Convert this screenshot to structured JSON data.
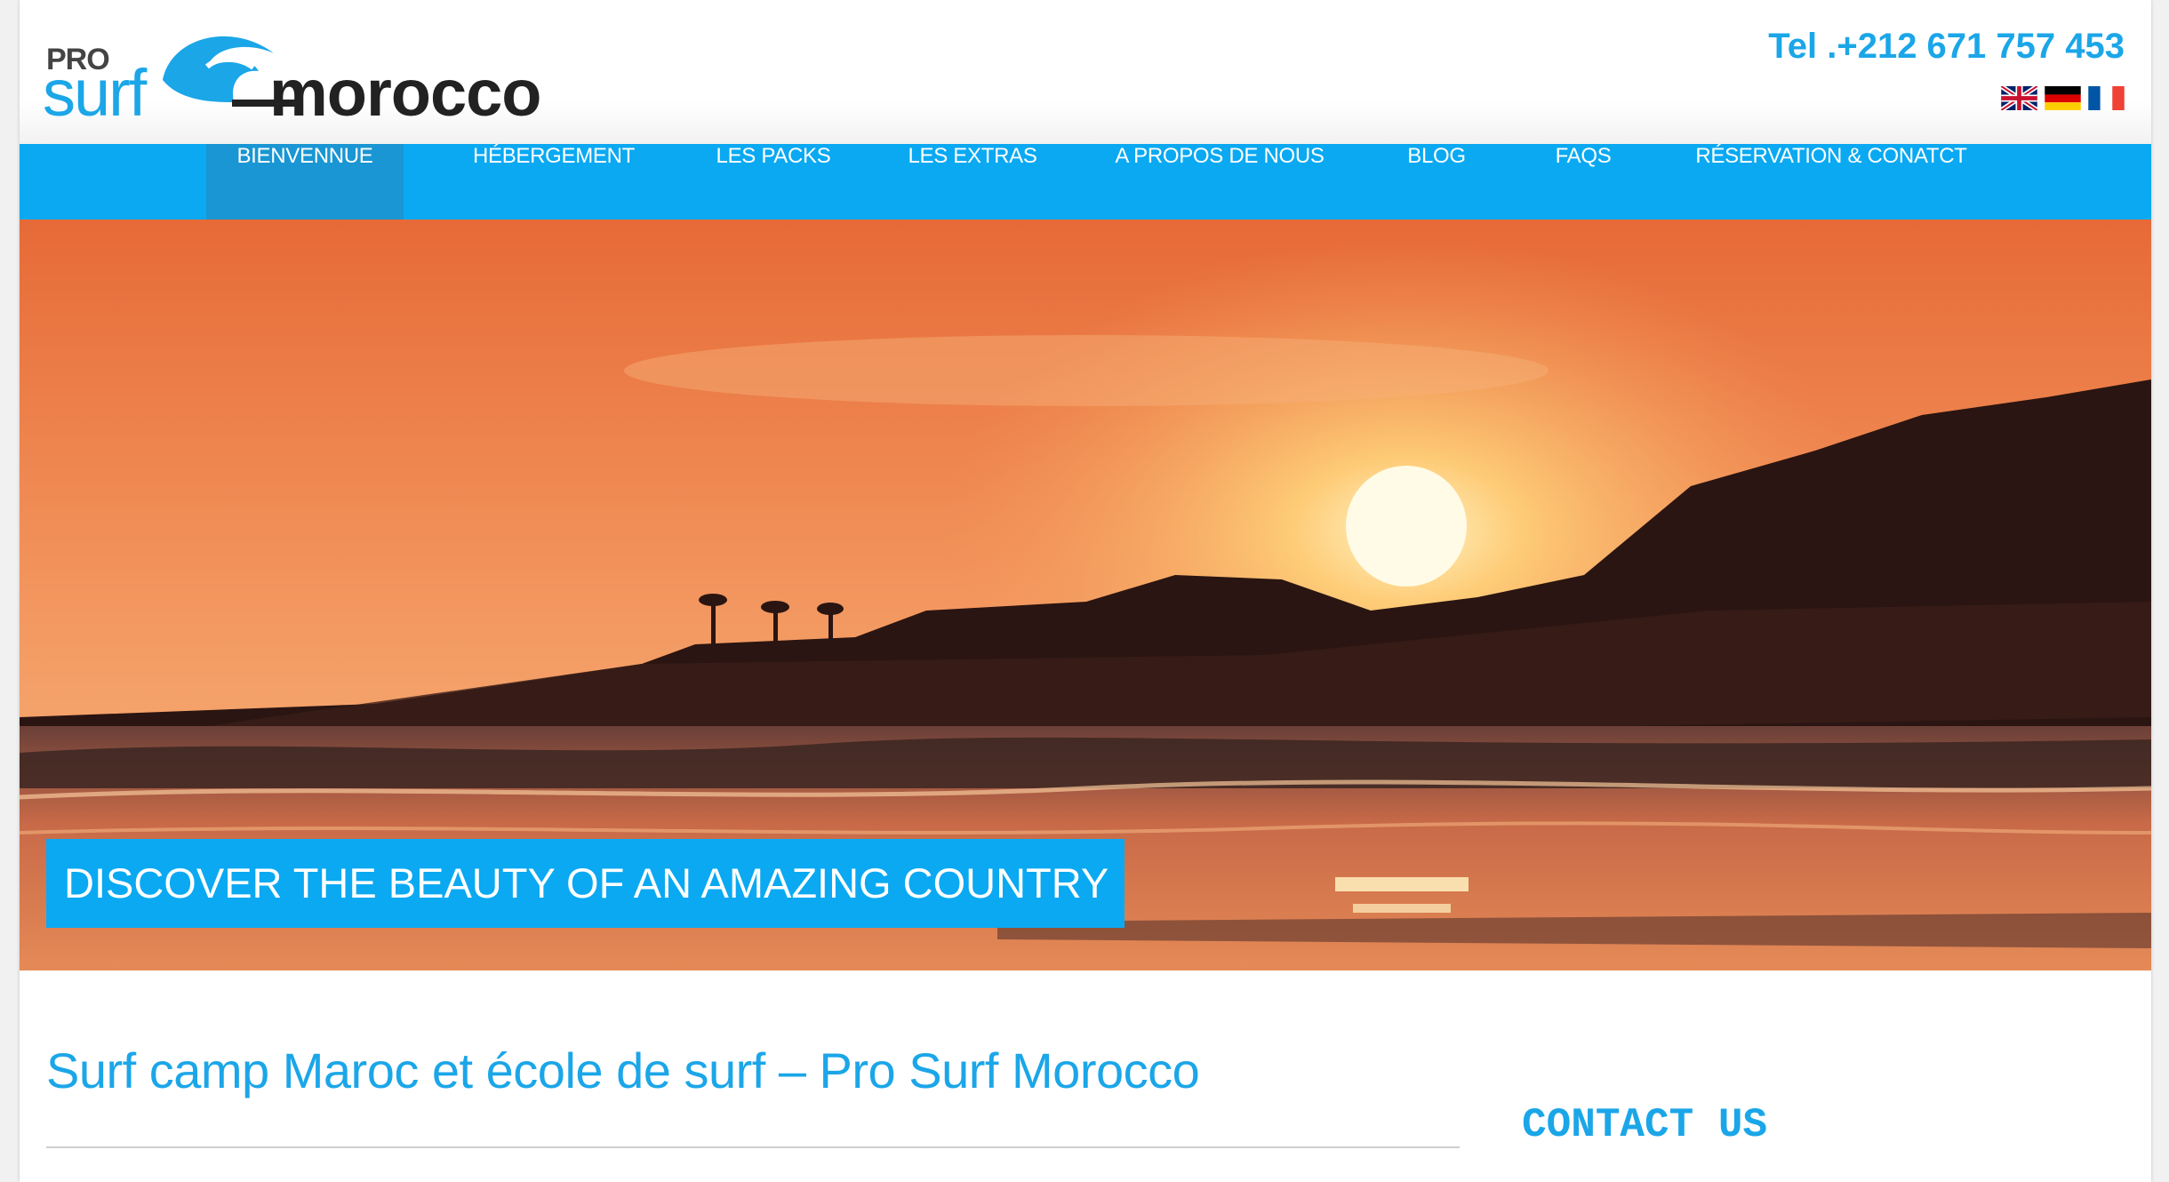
{
  "brand": {
    "logo_pro": "PRO",
    "logo_surf": "surf",
    "logo_morocco": "morocco",
    "primary_color": "#0aa9f2",
    "active_nav_color": "#1996d3"
  },
  "header": {
    "phone": "Tel .+212 671 757 453",
    "languages": [
      {
        "name": "English",
        "icon": "uk-flag-icon"
      },
      {
        "name": "Deutsch",
        "icon": "germany-flag-icon"
      },
      {
        "name": "Français",
        "icon": "france-flag-icon"
      }
    ]
  },
  "nav": {
    "items": [
      {
        "label": "BIENVENNUE",
        "active": true
      },
      {
        "label": "HÉBERGEMENT",
        "active": false
      },
      {
        "label": "LES PACKS",
        "active": false
      },
      {
        "label": "LES EXTRAS",
        "active": false
      },
      {
        "label": "A PROPOS DE NOUS",
        "active": false
      },
      {
        "label": "BLOG",
        "active": false
      },
      {
        "label": "FAQS",
        "active": false
      },
      {
        "label": "RÉSERVATION & CONATCT",
        "active": false
      }
    ]
  },
  "hero": {
    "tagline": "DISCOVER THE BEAUTY OF AN AMAZING COUNTRY",
    "image": "sunset-beach-image"
  },
  "main": {
    "title": "Surf camp Maroc et école de surf – Pro Surf Morocco"
  },
  "sidebar": {
    "contact_heading": "CONTACT US"
  }
}
